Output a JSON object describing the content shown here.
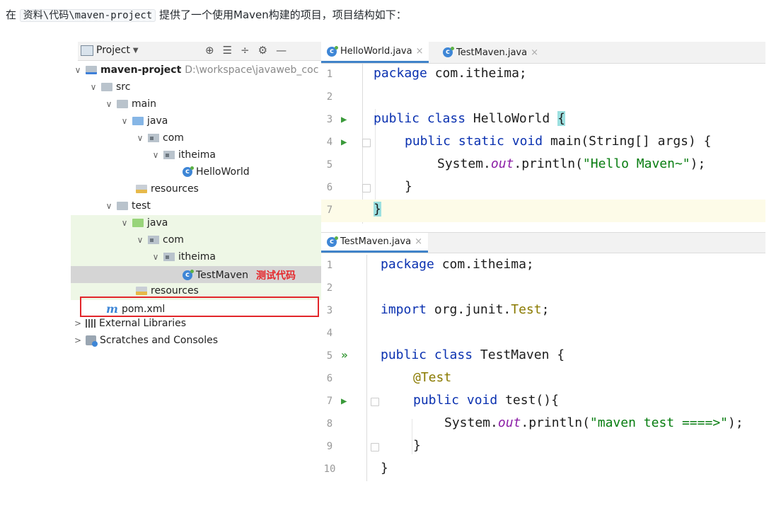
{
  "intro": {
    "prefix": "在",
    "path": "资料\\代码\\maven-project",
    "suffix": "提供了一个使用Maven构建的项目，项目结构如下："
  },
  "project_panel": {
    "title": "Project",
    "caret": "▼",
    "tools": [
      "⊕",
      "☰",
      "÷",
      "⚙",
      "—"
    ],
    "tree": [
      {
        "label": "maven-project",
        "extra": "D:\\workspace\\javaweb_coc",
        "arrow": "∨",
        "icon": "module-folder-icon",
        "name": "tree-item-maven-project"
      },
      {
        "label": "src",
        "arrow": "∨",
        "icon": "folder-icon",
        "name": "tree-item-src"
      },
      {
        "label": "main",
        "arrow": "∨",
        "icon": "folder-icon",
        "name": "tree-item-main"
      },
      {
        "label": "java",
        "arrow": "∨",
        "icon": "source-folder-icon",
        "name": "tree-item-main-java"
      },
      {
        "label": "com",
        "arrow": "∨",
        "icon": "package-icon",
        "name": "tree-item-main-com"
      },
      {
        "label": "itheima",
        "arrow": "∨",
        "icon": "package-icon",
        "name": "tree-item-main-itheima"
      },
      {
        "label": "HelloWorld",
        "arrow": "",
        "icon": "java-class-icon",
        "name": "tree-item-helloworld"
      },
      {
        "label": "resources",
        "arrow": "",
        "icon": "resources-folder-icon",
        "name": "tree-item-main-resources"
      },
      {
        "label": "test",
        "arrow": "∨",
        "icon": "folder-icon",
        "name": "tree-item-test"
      },
      {
        "label": "java",
        "arrow": "∨",
        "icon": "test-source-folder-icon",
        "name": "tree-item-test-java"
      },
      {
        "label": "com",
        "arrow": "∨",
        "icon": "package-icon",
        "name": "tree-item-test-com"
      },
      {
        "label": "itheima",
        "arrow": "∨",
        "icon": "package-icon",
        "name": "tree-item-test-itheima"
      },
      {
        "label": "TestMaven",
        "arrow": "",
        "icon": "java-class-icon",
        "name": "tree-item-testmaven",
        "annotation": "测试代码"
      },
      {
        "label": "resources",
        "arrow": "",
        "icon": "test-resources-folder-icon",
        "name": "tree-item-test-resources"
      },
      {
        "label": "pom.xml",
        "arrow": "",
        "icon": "maven-icon",
        "icon_text": "m",
        "name": "tree-item-pom"
      },
      {
        "label": "External Libraries",
        "arrow": ">",
        "icon": "libraries-icon",
        "name": "tree-item-external-libraries"
      },
      {
        "label": "Scratches and Consoles",
        "arrow": ">",
        "icon": "scratches-icon",
        "name": "tree-item-scratches"
      }
    ]
  },
  "editor1": {
    "tabs": [
      {
        "label": "HelloWorld.java",
        "close": "×",
        "active": true
      },
      {
        "label": "TestMaven.java",
        "close": "×",
        "active": false
      }
    ],
    "lines": [
      {
        "n": "1",
        "run": ""
      },
      {
        "n": "2",
        "run": ""
      },
      {
        "n": "3",
        "run": "▶"
      },
      {
        "n": "4",
        "run": "▶"
      },
      {
        "n": "5",
        "run": ""
      },
      {
        "n": "6",
        "run": ""
      },
      {
        "n": "7",
        "run": ""
      }
    ],
    "code": {
      "l1": [
        "package",
        " com.itheima;"
      ],
      "l3": [
        "public",
        " ",
        "class",
        " HelloWorld ",
        "{"
      ],
      "l4": [
        "public",
        " ",
        "static",
        " ",
        "void",
        " main(String[] args) {"
      ],
      "l5": [
        "System.",
        "out",
        ".println(",
        "\"Hello Maven~\"",
        ");"
      ],
      "l6": [
        "}"
      ],
      "l7": [
        "}"
      ]
    }
  },
  "editor2": {
    "tab": {
      "label": "TestMaven.java",
      "close": "×"
    },
    "lines": [
      {
        "n": "1",
        "run": ""
      },
      {
        "n": "2",
        "run": ""
      },
      {
        "n": "3",
        "run": ""
      },
      {
        "n": "4",
        "run": ""
      },
      {
        "n": "5",
        "run": "»"
      },
      {
        "n": "6",
        "run": ""
      },
      {
        "n": "7",
        "run": "▶"
      },
      {
        "n": "8",
        "run": ""
      },
      {
        "n": "9",
        "run": ""
      },
      {
        "n": "10",
        "run": ""
      }
    ],
    "code": {
      "l1": [
        "package",
        " com.itheima;"
      ],
      "l3": [
        "import",
        " org.junit.",
        "Test",
        ";"
      ],
      "l5": [
        "public",
        " ",
        "class",
        " TestMaven {"
      ],
      "l6": [
        "@Test"
      ],
      "l7": [
        "public",
        " ",
        "void",
        " test(){"
      ],
      "l8": [
        "System.",
        "out",
        ".println(",
        "\"maven test ====>\"",
        ");"
      ],
      "l9": [
        "}"
      ],
      "l10": [
        "}"
      ]
    }
  },
  "icon_text": {
    "class": "c"
  }
}
